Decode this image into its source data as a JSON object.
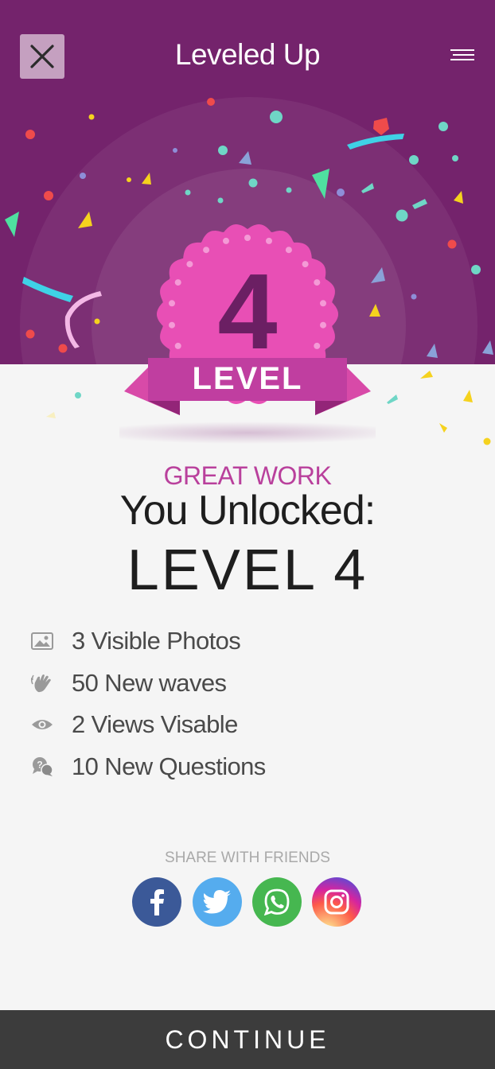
{
  "header": {
    "title": "Leveled Up",
    "background": "#74236c",
    "close_icon": "close-icon",
    "menu_icon": "hamburger-menu-icon"
  },
  "badge": {
    "number": "4",
    "ribbon_label": "LEVEL",
    "color": "#e84fb5"
  },
  "main": {
    "kicker": "GREAT WORK",
    "headline": "You Unlocked:",
    "level": "LEVEL 4"
  },
  "features": [
    {
      "icon": "photo-icon",
      "text": "3 Visible Photos"
    },
    {
      "icon": "wave-hand-icon",
      "text": "50 New waves"
    },
    {
      "icon": "eye-icon",
      "text": "2 Views Visable"
    },
    {
      "icon": "question-chat-icon",
      "text": "10 New Questions"
    }
  ],
  "share": {
    "label": "SHARE WITH FRIENDS",
    "networks": [
      {
        "name": "facebook-icon",
        "color": "#3b5998"
      },
      {
        "name": "twitter-icon",
        "color": "#55acee"
      },
      {
        "name": "whatsapp-icon",
        "color": "#46b750"
      },
      {
        "name": "instagram-icon",
        "color": "#d6249f"
      }
    ]
  },
  "continue_label": "CONTINUE"
}
